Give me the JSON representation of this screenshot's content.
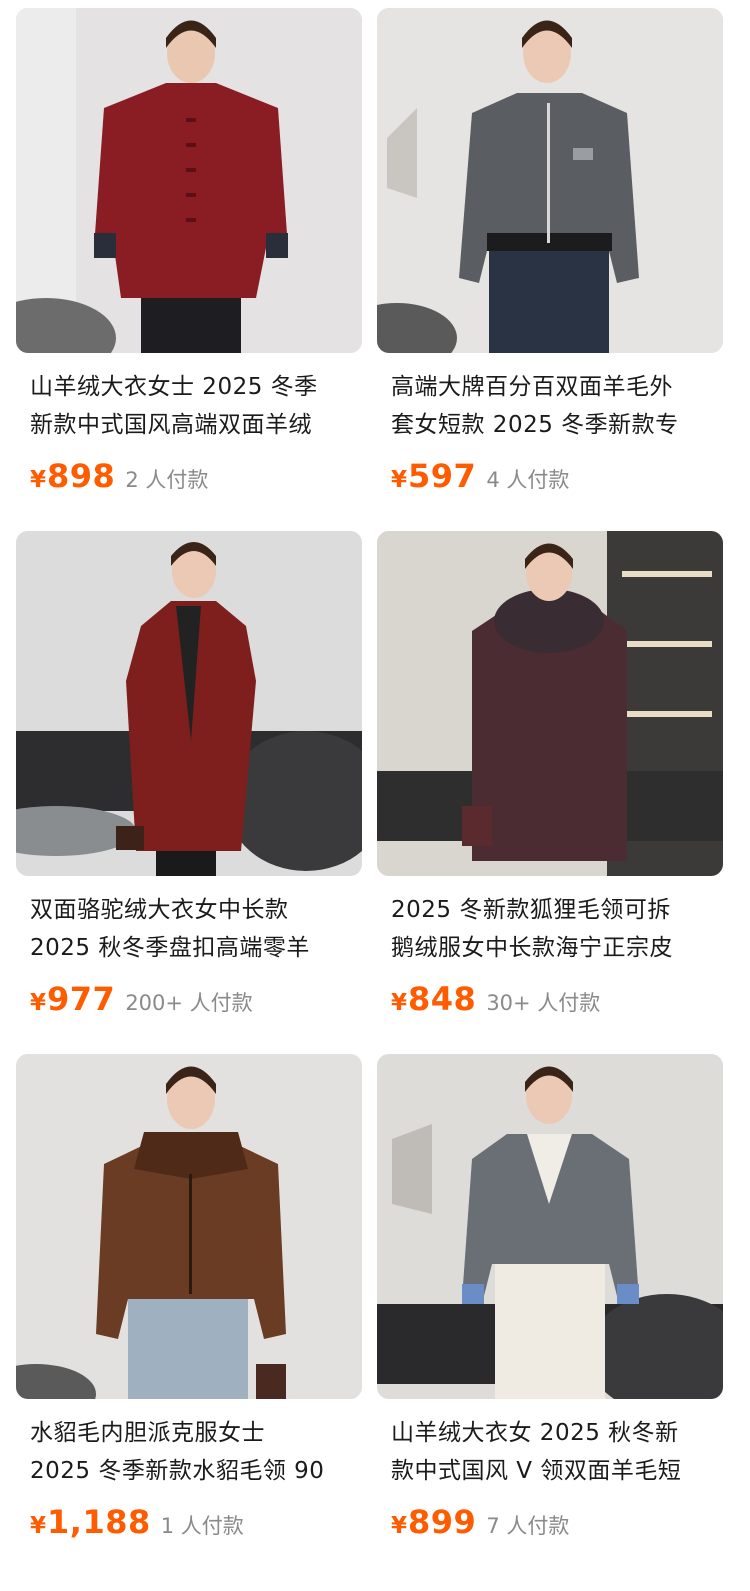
{
  "products": [
    {
      "title_line1": "山羊绒大衣女士 2025 冬季",
      "title_line2": "新款中式国风高端双面羊绒",
      "currency": "¥",
      "price": "898",
      "sold": "2 人付款",
      "coat_color": "#8a1c24",
      "bg_color": "#e4e2e3"
    },
    {
      "title_line1": "高端大牌百分百双面羊毛外",
      "title_line2": "套女短款 2025 冬季新款专",
      "currency": "¥",
      "price": "597",
      "sold": "4 人付款",
      "coat_color": "#5a5d61",
      "bg_color": "#e6e4e2"
    },
    {
      "title_line1": "双面骆驼绒大衣女中长款",
      "title_line2": "2025 秋冬季盘扣高端零羊",
      "currency": "¥",
      "price": "977",
      "sold": "200+ 人付款",
      "coat_color": "#7e1f1e",
      "bg_color": "#dcdcdc"
    },
    {
      "title_line1": "2025 冬新款狐狸毛领可拆",
      "title_line2": "鹅绒服女中长款海宁正宗皮",
      "currency": "¥",
      "price": "848",
      "sold": "30+ 人付款",
      "coat_color": "#4a2c32",
      "bg_color": "#d9d5cf"
    },
    {
      "title_line1": "水貂毛内胆派克服女士",
      "title_line2": "2025 冬季新款水貂毛领 90",
      "currency": "¥",
      "price": "1,188",
      "sold": "1 人付款",
      "coat_color": "#6b3c24",
      "bg_color": "#e3e1df"
    },
    {
      "title_line1": "山羊绒大衣女 2025 秋冬新",
      "title_line2": "款中式国风 V 领双面羊毛短",
      "currency": "¥",
      "price": "899",
      "sold": "7 人付款",
      "coat_color": "#6a6f75",
      "bg_color": "#dedcd9"
    }
  ]
}
